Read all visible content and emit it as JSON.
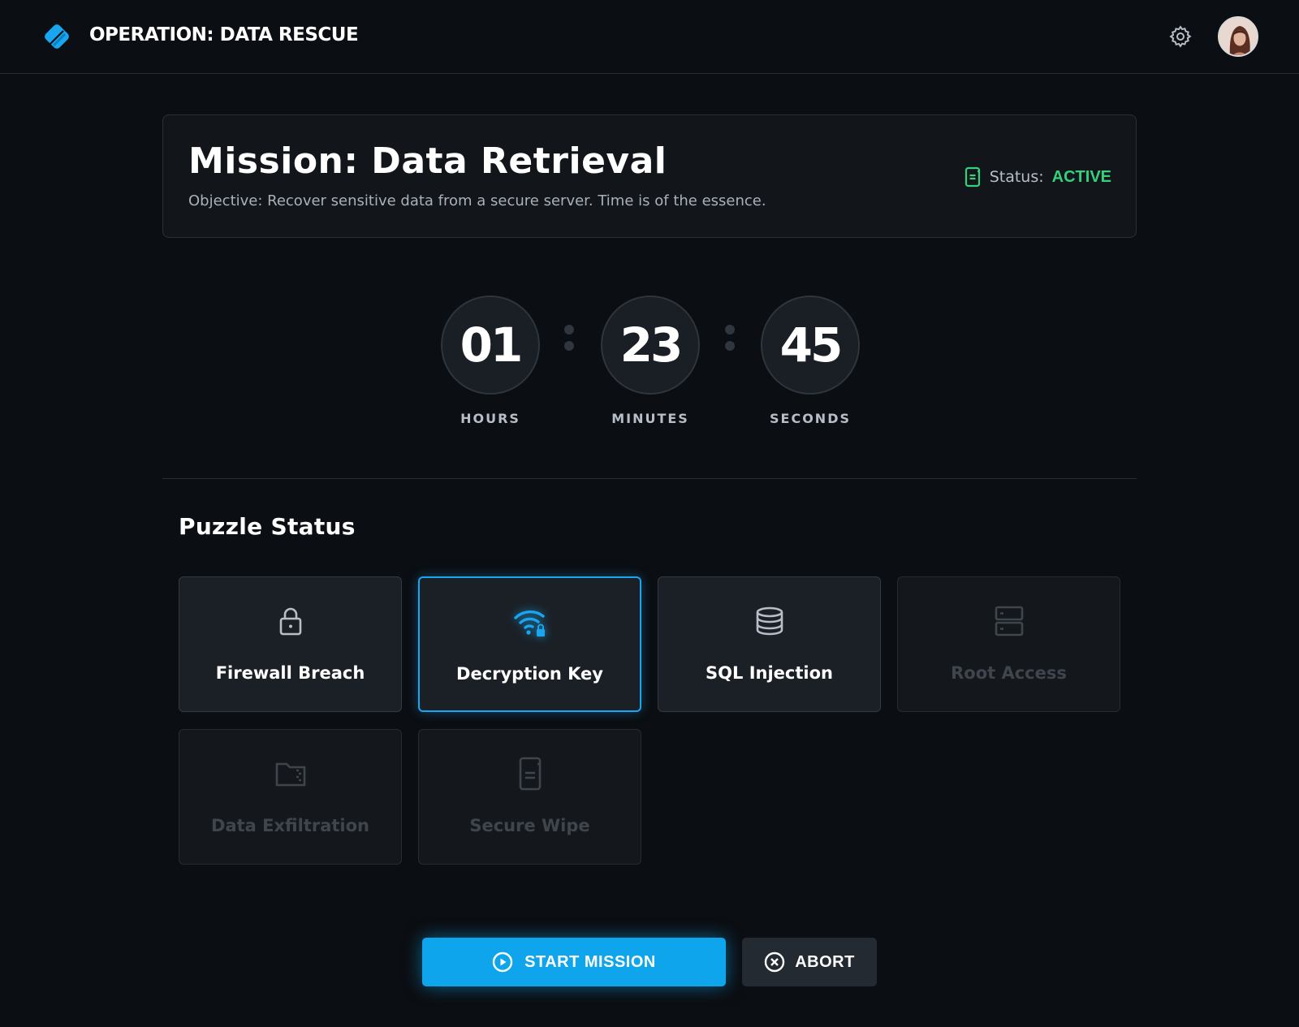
{
  "header": {
    "app_title": "OPERATION: DATA RESCUE",
    "logo_icon": "diamond-logo-icon",
    "settings_icon": "gear-icon",
    "avatar_icon": "user-avatar"
  },
  "mission": {
    "title": "Mission: Data Retrieval",
    "objective": "Objective: Recover sensitive data from a secure server. Time is of the essence.",
    "status_label": "Status:",
    "status_value": "ACTIVE",
    "status_icon": "document-icon"
  },
  "timer": {
    "hours": "01",
    "hours_label": "HOURS",
    "minutes": "23",
    "minutes_label": "MINUTES",
    "seconds": "45",
    "seconds_label": "SECONDS"
  },
  "puzzles": {
    "title": "Puzzle Status",
    "items": [
      {
        "label": "Firewall Breach",
        "icon": "lock-icon",
        "state": "unlocked"
      },
      {
        "label": "Decryption Key",
        "icon": "wifi-lock-icon",
        "state": "active"
      },
      {
        "label": "SQL Injection",
        "icon": "database-icon",
        "state": "unlocked"
      },
      {
        "label": "Root Access",
        "icon": "server-icon",
        "state": "locked"
      },
      {
        "label": "Data Exfiltration",
        "icon": "folder-zip-icon",
        "state": "locked"
      },
      {
        "label": "Secure Wipe",
        "icon": "document-icon",
        "state": "locked"
      }
    ]
  },
  "actions": {
    "start_label": "START MISSION",
    "start_icon": "play-circle-icon",
    "abort_label": "ABORT",
    "abort_icon": "close-circle-icon"
  },
  "colors": {
    "background": "#0b0e12",
    "accent": "#0ea5ec",
    "status_active": "#36d07c",
    "card": "#12161b",
    "tile": "#1b2026",
    "tile_locked_text": "#3f454d"
  }
}
